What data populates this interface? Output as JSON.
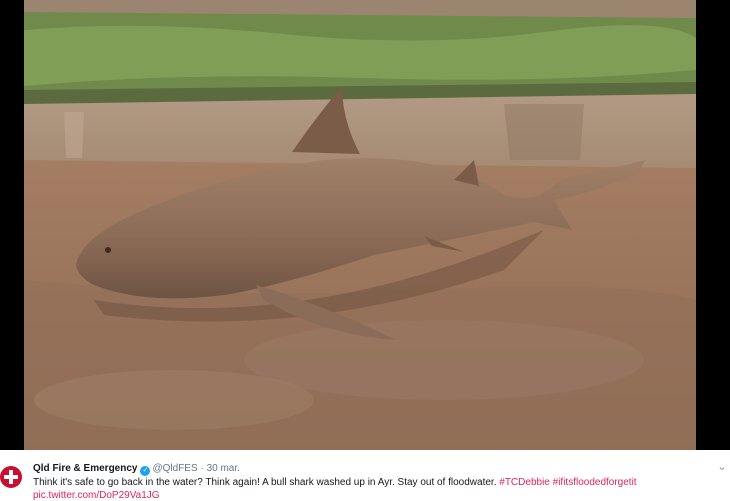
{
  "tweet": {
    "author_name": "Qld Fire & Emergency",
    "handle": "@QldFES",
    "separator": "·",
    "date": "30 mar.",
    "text": "Think it's safe to go back in the water? Think again! A bull shark washed up in Ayr. Stay out of floodwater.",
    "hashtags": [
      "#TCDebbie",
      "#ifitsfloodedforgetit"
    ],
    "link": "pic.twitter.com/DoP29Va1JG"
  },
  "icons": {
    "avatar": "qfes-logo-avatar",
    "verified": "verified-badge-icon",
    "menu": "chevron-down-icon"
  },
  "colors": {
    "hashtag": "#e0245e",
    "verified": "#1da1f2"
  }
}
